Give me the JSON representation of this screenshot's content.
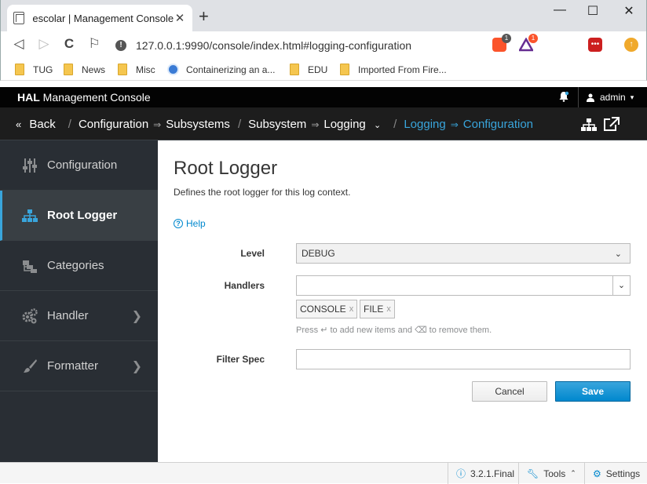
{
  "browser": {
    "tab_title": "escolar | Management Console",
    "tab_close": "✕",
    "new_tab": "+",
    "minimize": "—",
    "maximize": "☐",
    "close": "✕",
    "url": "127.0.0.1:9990/console/index.html#logging-configuration",
    "back": "◁",
    "forward": "▷",
    "reload": "C",
    "bookmark": "⚐",
    "ext_badge_1": "1",
    "ext_badge_2": "1",
    "bookmarks": [
      "TUG",
      "News",
      "Misc",
      "Containerizing an a...",
      "EDU",
      "Imported From Fire..."
    ]
  },
  "hal": {
    "brand_bold": "HAL",
    "brand_rest": "Management Console",
    "user": "admin",
    "breadcrumb": {
      "back": "Back",
      "configuration": "Configuration",
      "subsystems": "Subsystems",
      "subsystem": "Subsystem",
      "logging": "Logging",
      "logging_active": "Logging",
      "configuration_active": "Configuration"
    }
  },
  "sidebar": {
    "items": [
      {
        "label": "Configuration",
        "icon": "sliders-icon"
      },
      {
        "label": "Root Logger",
        "icon": "sitemap-icon"
      },
      {
        "label": "Categories",
        "icon": "folders-icon"
      },
      {
        "label": "Handler",
        "icon": "gears-icon"
      },
      {
        "label": "Formatter",
        "icon": "brush-icon"
      }
    ],
    "active": "Root Logger"
  },
  "main": {
    "title": "Root Logger",
    "description": "Defines the root logger for this log context.",
    "help": "Help",
    "form": {
      "level_label": "Level",
      "level_value": "DEBUG",
      "handlers_label": "Handlers",
      "handlers_tags": [
        "CONSOLE",
        "FILE"
      ],
      "tag_remove": "x",
      "hint": "Press ↵ to add new items and ⌫ to remove them.",
      "filter_label": "Filter Spec",
      "filter_value": "",
      "cancel": "Cancel",
      "save": "Save"
    }
  },
  "footer": {
    "version": "3.2.1.Final",
    "tools": "Tools",
    "settings": "Settings"
  },
  "colors": {
    "accent": "#39a5dc",
    "primary_button": "#0088ce",
    "sidebar_bg": "#292e34",
    "header_bg": "#030303"
  }
}
